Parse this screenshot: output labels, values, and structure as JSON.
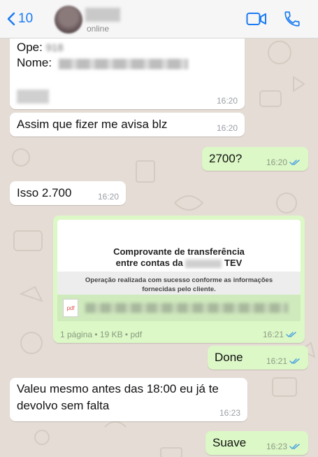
{
  "header": {
    "back_count": "10",
    "status": "online"
  },
  "messages": {
    "m1": {
      "ope_label": "Ope:",
      "ope_value": "918",
      "nome_label": "Nome:",
      "time": "16:20"
    },
    "m2": {
      "text": "Assim que fizer me avisa blz",
      "time": "16:20"
    },
    "m3": {
      "text": "2700?",
      "time": "16:20"
    },
    "m4": {
      "text": "Isso 2.700",
      "time": "16:20"
    },
    "m5": {
      "title_line1": "Comprovante de transferência",
      "title_line2_prefix": "entre contas da",
      "title_line2_suffix": "TEV",
      "note_line1": "Operação realizada com sucesso conforme as informações",
      "note_line2": "fornecidas pelo cliente.",
      "pdf_label": "pdf",
      "file_info": "1 página • 19 KB • pdf",
      "time": "16:21"
    },
    "m6": {
      "text": "Done",
      "time": "16:21"
    },
    "m7": {
      "line1": "Valeu mesmo antes das 18:00 eu já te",
      "line2": "devolvo sem falta",
      "time": "16:23"
    },
    "m8": {
      "text": "Suave",
      "time": "16:23"
    }
  },
  "colors": {
    "background": "#e5ddd5",
    "incoming": "#ffffff",
    "outgoing": "#dcf8c6",
    "accent": "#1a7bf2",
    "read_ticks": "#4fa3e0"
  }
}
